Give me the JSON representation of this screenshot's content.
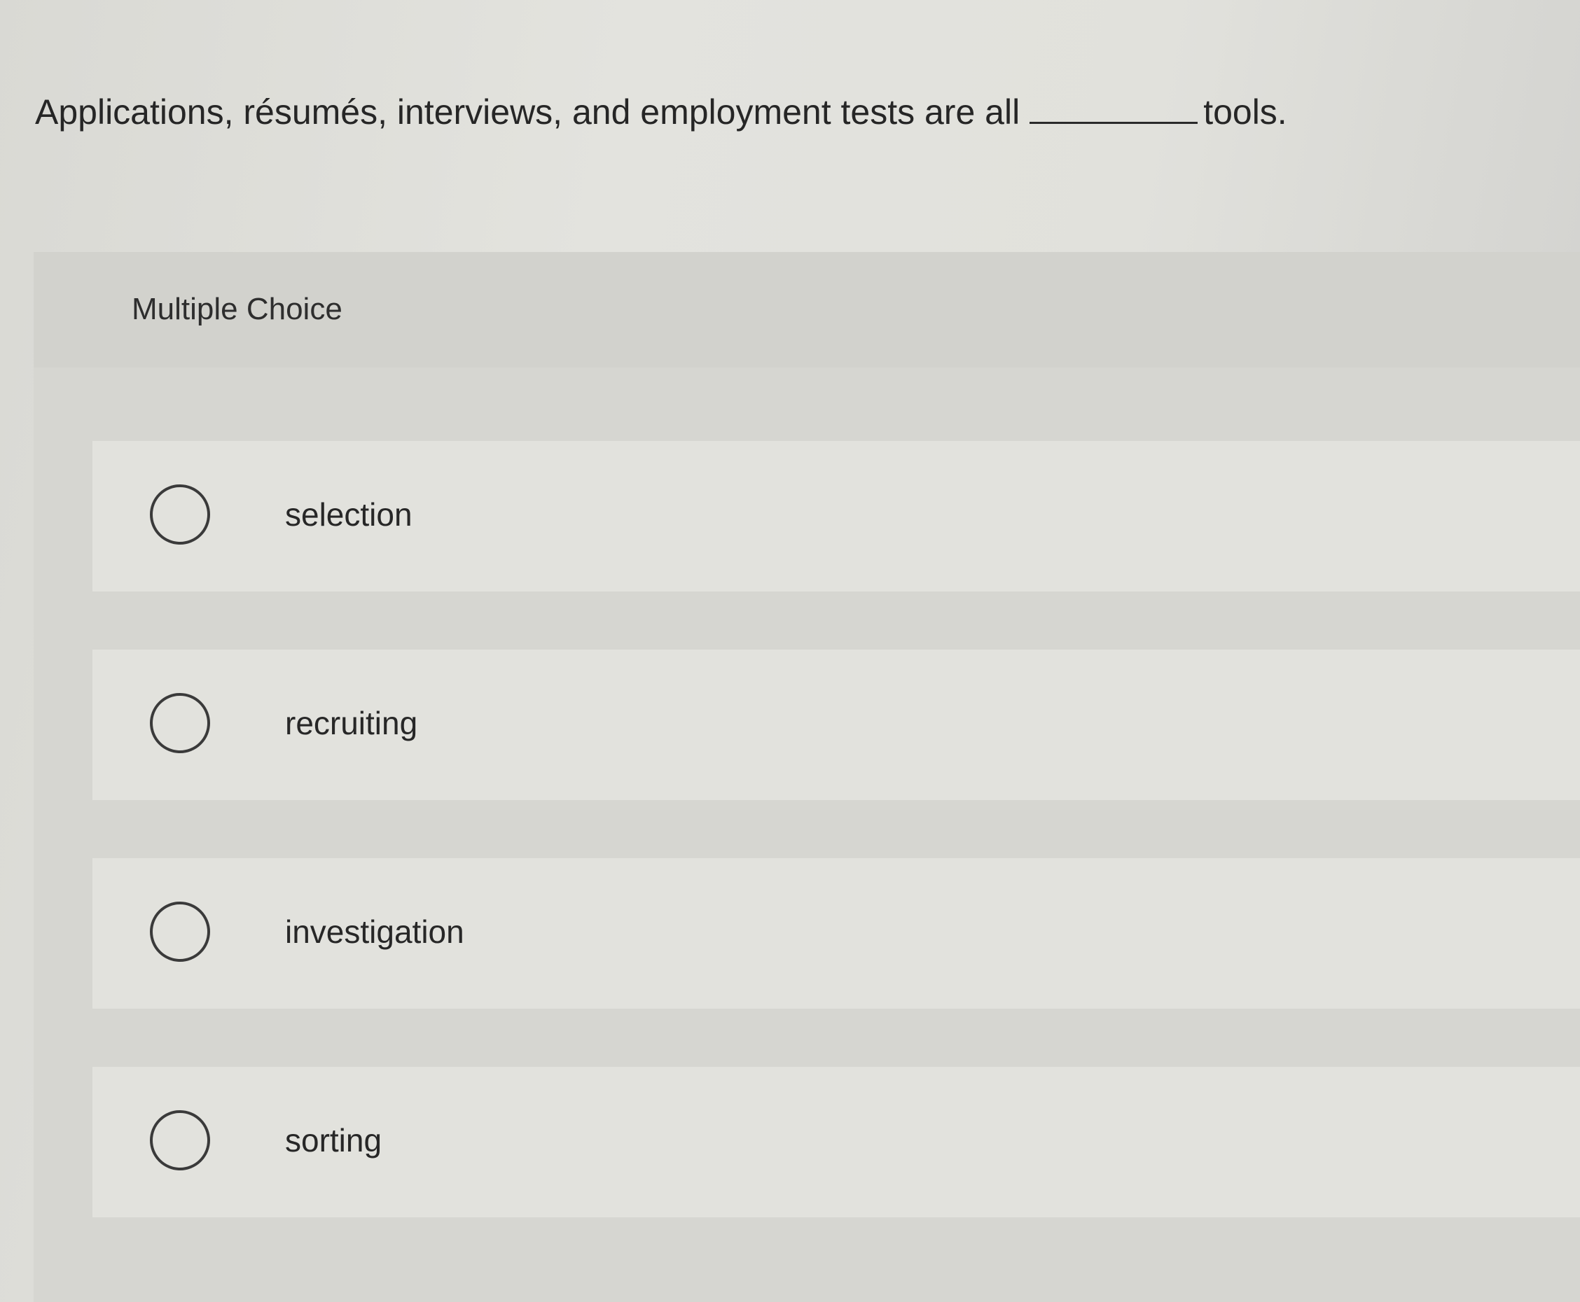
{
  "question": {
    "text_before": "Applications, résumés, interviews, and employment tests are all",
    "text_after": "tools."
  },
  "panel": {
    "title": "Multiple Choice"
  },
  "options": [
    {
      "label": "selection",
      "selected": false
    },
    {
      "label": "recruiting",
      "selected": false
    },
    {
      "label": "investigation",
      "selected": false
    },
    {
      "label": "sorting",
      "selected": false
    }
  ]
}
